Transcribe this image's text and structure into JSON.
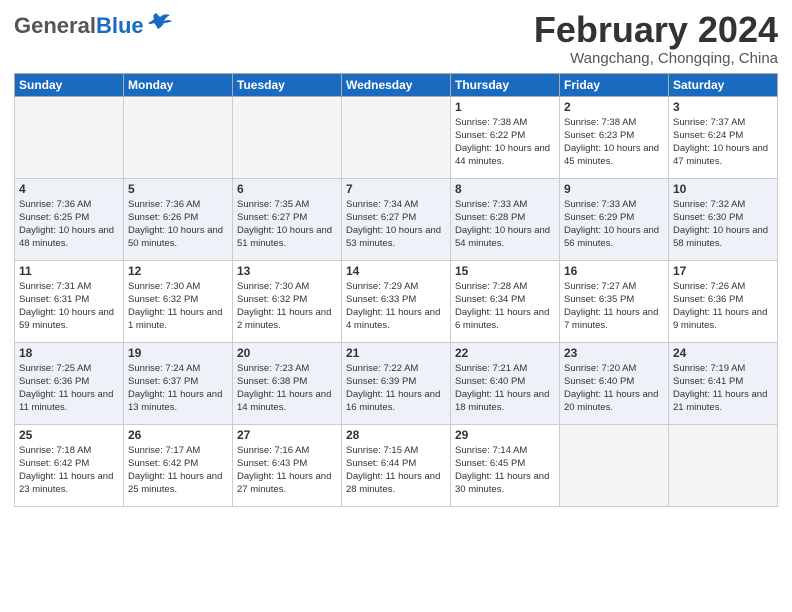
{
  "logo": {
    "general": "General",
    "blue": "Blue"
  },
  "title": "February 2024",
  "subtitle": "Wangchang, Chongqing, China",
  "days_of_week": [
    "Sunday",
    "Monday",
    "Tuesday",
    "Wednesday",
    "Thursday",
    "Friday",
    "Saturday"
  ],
  "weeks": [
    [
      {
        "day": "",
        "sunrise": "",
        "sunset": "",
        "daylight": ""
      },
      {
        "day": "",
        "sunrise": "",
        "sunset": "",
        "daylight": ""
      },
      {
        "day": "",
        "sunrise": "",
        "sunset": "",
        "daylight": ""
      },
      {
        "day": "",
        "sunrise": "",
        "sunset": "",
        "daylight": ""
      },
      {
        "day": "1",
        "sunrise": "Sunrise: 7:38 AM",
        "sunset": "Sunset: 6:22 PM",
        "daylight": "Daylight: 10 hours and 44 minutes."
      },
      {
        "day": "2",
        "sunrise": "Sunrise: 7:38 AM",
        "sunset": "Sunset: 6:23 PM",
        "daylight": "Daylight: 10 hours and 45 minutes."
      },
      {
        "day": "3",
        "sunrise": "Sunrise: 7:37 AM",
        "sunset": "Sunset: 6:24 PM",
        "daylight": "Daylight: 10 hours and 47 minutes."
      }
    ],
    [
      {
        "day": "4",
        "sunrise": "Sunrise: 7:36 AM",
        "sunset": "Sunset: 6:25 PM",
        "daylight": "Daylight: 10 hours and 48 minutes."
      },
      {
        "day": "5",
        "sunrise": "Sunrise: 7:36 AM",
        "sunset": "Sunset: 6:26 PM",
        "daylight": "Daylight: 10 hours and 50 minutes."
      },
      {
        "day": "6",
        "sunrise": "Sunrise: 7:35 AM",
        "sunset": "Sunset: 6:27 PM",
        "daylight": "Daylight: 10 hours and 51 minutes."
      },
      {
        "day": "7",
        "sunrise": "Sunrise: 7:34 AM",
        "sunset": "Sunset: 6:27 PM",
        "daylight": "Daylight: 10 hours and 53 minutes."
      },
      {
        "day": "8",
        "sunrise": "Sunrise: 7:33 AM",
        "sunset": "Sunset: 6:28 PM",
        "daylight": "Daylight: 10 hours and 54 minutes."
      },
      {
        "day": "9",
        "sunrise": "Sunrise: 7:33 AM",
        "sunset": "Sunset: 6:29 PM",
        "daylight": "Daylight: 10 hours and 56 minutes."
      },
      {
        "day": "10",
        "sunrise": "Sunrise: 7:32 AM",
        "sunset": "Sunset: 6:30 PM",
        "daylight": "Daylight: 10 hours and 58 minutes."
      }
    ],
    [
      {
        "day": "11",
        "sunrise": "Sunrise: 7:31 AM",
        "sunset": "Sunset: 6:31 PM",
        "daylight": "Daylight: 10 hours and 59 minutes."
      },
      {
        "day": "12",
        "sunrise": "Sunrise: 7:30 AM",
        "sunset": "Sunset: 6:32 PM",
        "daylight": "Daylight: 11 hours and 1 minute."
      },
      {
        "day": "13",
        "sunrise": "Sunrise: 7:30 AM",
        "sunset": "Sunset: 6:32 PM",
        "daylight": "Daylight: 11 hours and 2 minutes."
      },
      {
        "day": "14",
        "sunrise": "Sunrise: 7:29 AM",
        "sunset": "Sunset: 6:33 PM",
        "daylight": "Daylight: 11 hours and 4 minutes."
      },
      {
        "day": "15",
        "sunrise": "Sunrise: 7:28 AM",
        "sunset": "Sunset: 6:34 PM",
        "daylight": "Daylight: 11 hours and 6 minutes."
      },
      {
        "day": "16",
        "sunrise": "Sunrise: 7:27 AM",
        "sunset": "Sunset: 6:35 PM",
        "daylight": "Daylight: 11 hours and 7 minutes."
      },
      {
        "day": "17",
        "sunrise": "Sunrise: 7:26 AM",
        "sunset": "Sunset: 6:36 PM",
        "daylight": "Daylight: 11 hours and 9 minutes."
      }
    ],
    [
      {
        "day": "18",
        "sunrise": "Sunrise: 7:25 AM",
        "sunset": "Sunset: 6:36 PM",
        "daylight": "Daylight: 11 hours and 11 minutes."
      },
      {
        "day": "19",
        "sunrise": "Sunrise: 7:24 AM",
        "sunset": "Sunset: 6:37 PM",
        "daylight": "Daylight: 11 hours and 13 minutes."
      },
      {
        "day": "20",
        "sunrise": "Sunrise: 7:23 AM",
        "sunset": "Sunset: 6:38 PM",
        "daylight": "Daylight: 11 hours and 14 minutes."
      },
      {
        "day": "21",
        "sunrise": "Sunrise: 7:22 AM",
        "sunset": "Sunset: 6:39 PM",
        "daylight": "Daylight: 11 hours and 16 minutes."
      },
      {
        "day": "22",
        "sunrise": "Sunrise: 7:21 AM",
        "sunset": "Sunset: 6:40 PM",
        "daylight": "Daylight: 11 hours and 18 minutes."
      },
      {
        "day": "23",
        "sunrise": "Sunrise: 7:20 AM",
        "sunset": "Sunset: 6:40 PM",
        "daylight": "Daylight: 11 hours and 20 minutes."
      },
      {
        "day": "24",
        "sunrise": "Sunrise: 7:19 AM",
        "sunset": "Sunset: 6:41 PM",
        "daylight": "Daylight: 11 hours and 21 minutes."
      }
    ],
    [
      {
        "day": "25",
        "sunrise": "Sunrise: 7:18 AM",
        "sunset": "Sunset: 6:42 PM",
        "daylight": "Daylight: 11 hours and 23 minutes."
      },
      {
        "day": "26",
        "sunrise": "Sunrise: 7:17 AM",
        "sunset": "Sunset: 6:42 PM",
        "daylight": "Daylight: 11 hours and 25 minutes."
      },
      {
        "day": "27",
        "sunrise": "Sunrise: 7:16 AM",
        "sunset": "Sunset: 6:43 PM",
        "daylight": "Daylight: 11 hours and 27 minutes."
      },
      {
        "day": "28",
        "sunrise": "Sunrise: 7:15 AM",
        "sunset": "Sunset: 6:44 PM",
        "daylight": "Daylight: 11 hours and 28 minutes."
      },
      {
        "day": "29",
        "sunrise": "Sunrise: 7:14 AM",
        "sunset": "Sunset: 6:45 PM",
        "daylight": "Daylight: 11 hours and 30 minutes."
      },
      {
        "day": "",
        "sunrise": "",
        "sunset": "",
        "daylight": ""
      },
      {
        "day": "",
        "sunrise": "",
        "sunset": "",
        "daylight": ""
      }
    ]
  ]
}
